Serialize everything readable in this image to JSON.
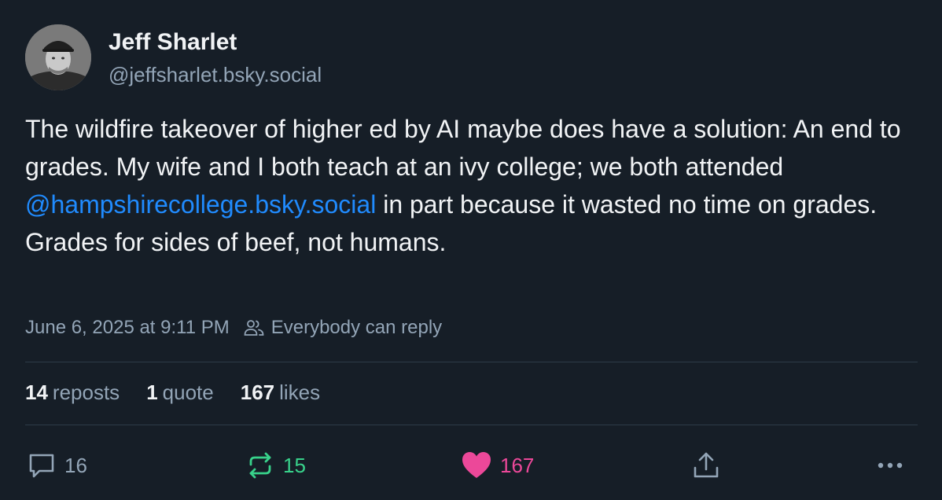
{
  "author": {
    "display_name": "Jeff Sharlet",
    "handle": "@jeffsharlet.bsky.social",
    "avatar_icon": "person-avatar"
  },
  "post": {
    "text_before": "The wildfire takeover of higher ed by AI maybe does have a solution: An end to grades. My wife and I both teach at an ivy college; we both attended ",
    "mention": "@hampshirecollege.bsky.social",
    "text_after": " in part because it wasted no time on grades. Grades for sides of beef, not humans.",
    "timestamp": "June 6, 2025 at 9:11 PM",
    "reply_setting": "Everybody can reply"
  },
  "stats": {
    "reposts": {
      "count": "14",
      "label": "reposts"
    },
    "quotes": {
      "count": "1",
      "label": "quote"
    },
    "likes": {
      "count": "167",
      "label": "likes"
    }
  },
  "actions": {
    "reply": {
      "icon": "speech-bubble-icon",
      "count": "16"
    },
    "repost": {
      "icon": "repost-icon",
      "count": "15"
    },
    "like": {
      "icon": "heart-icon",
      "count": "167"
    },
    "share": {
      "icon": "share-icon"
    },
    "more": {
      "icon": "ellipsis-icon"
    }
  },
  "colors": {
    "background": "#161e27",
    "text": "#f1f3f5",
    "muted": "#93a5b7",
    "link": "#208bfe",
    "repost_active": "#38d28b",
    "like_active": "#ec4899",
    "divider": "#2e3b48"
  }
}
